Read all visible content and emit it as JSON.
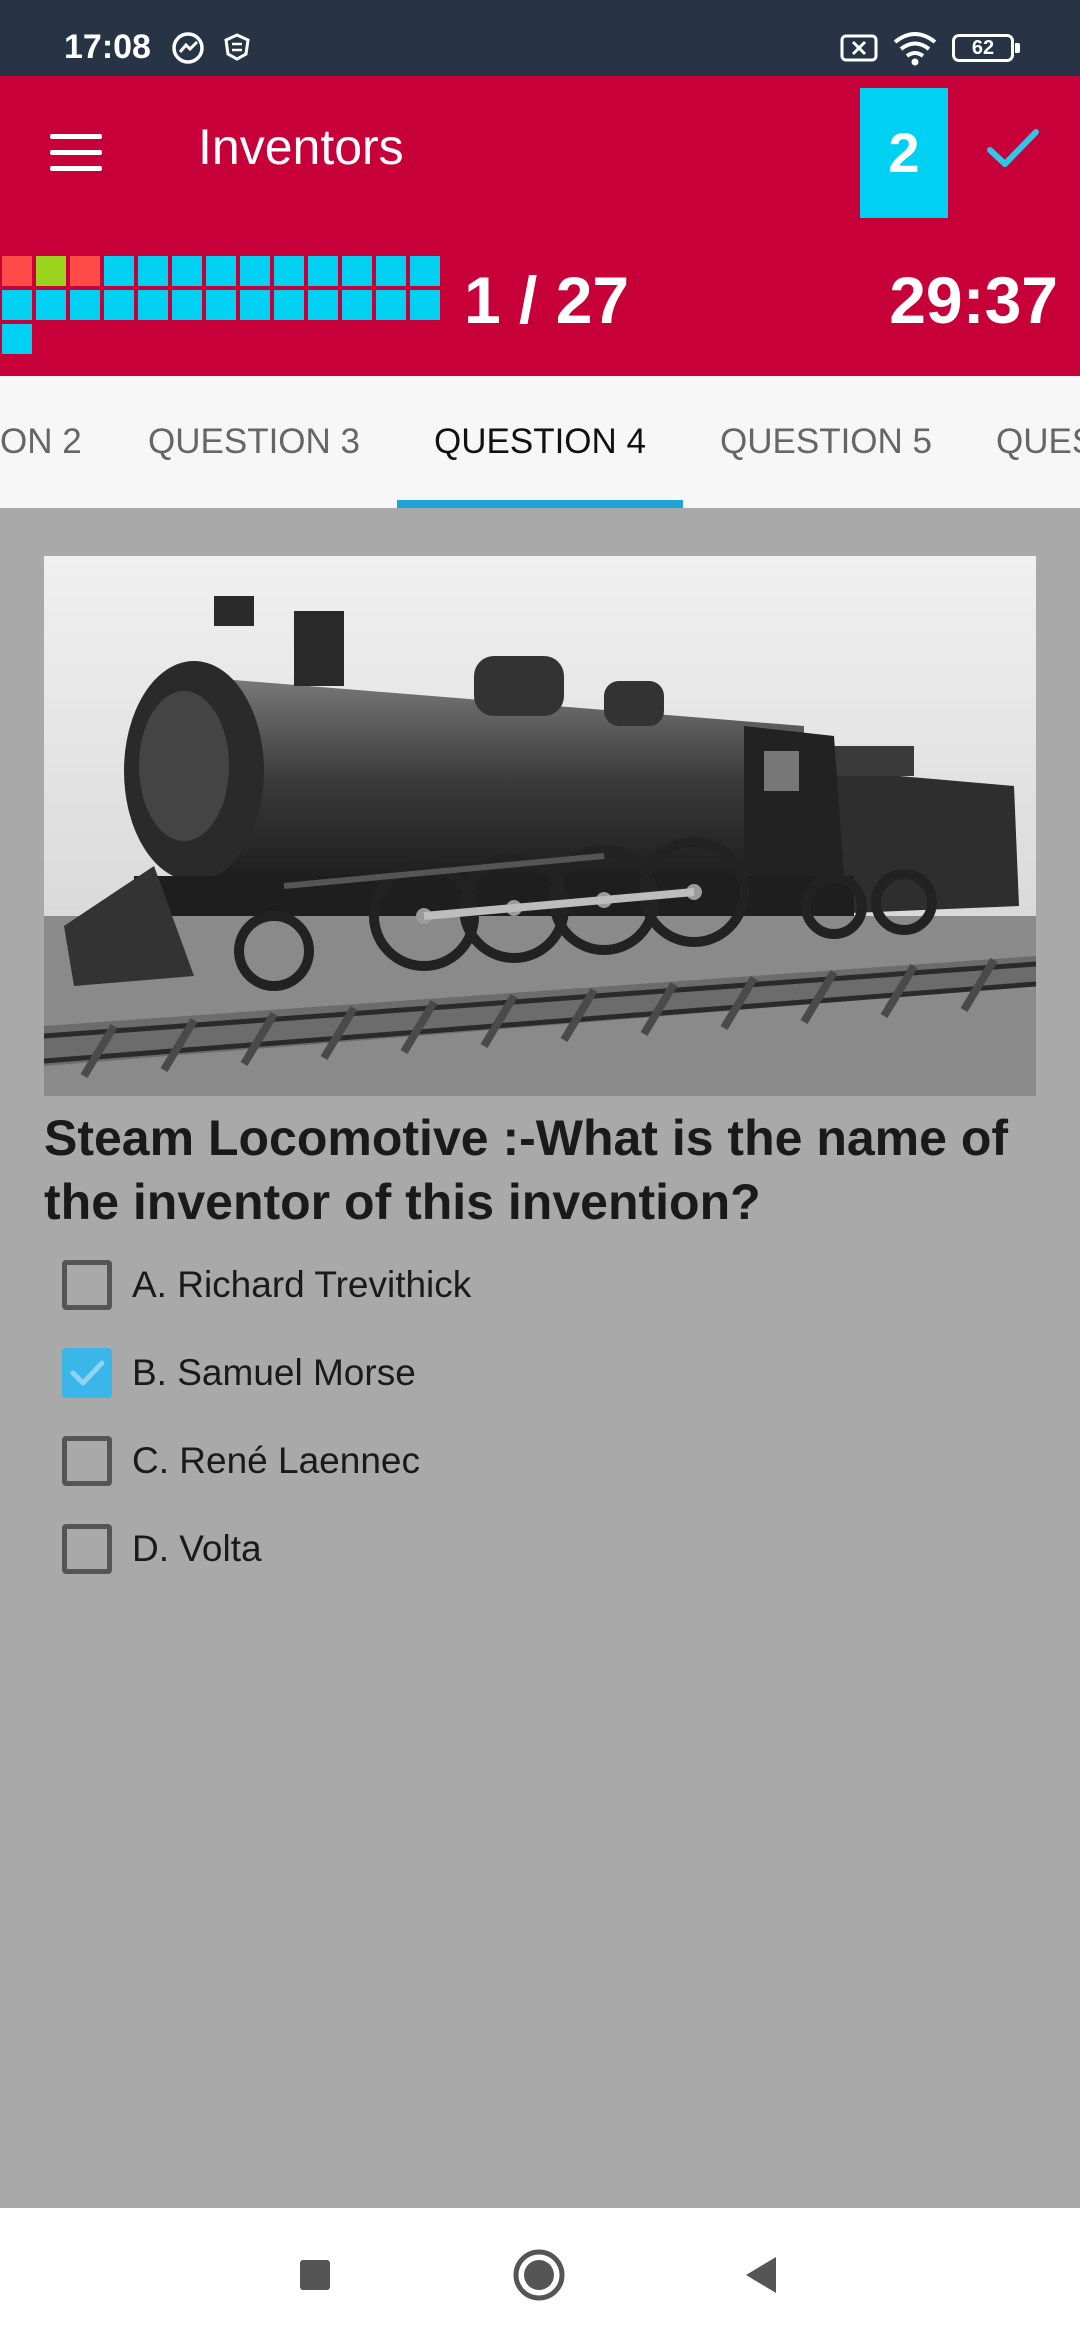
{
  "status_bar": {
    "time": "17:08",
    "battery": "62",
    "icons": [
      "chat-icon",
      "shield-icon",
      "sim-off-icon",
      "wifi-icon",
      "battery-icon"
    ]
  },
  "app_bar": {
    "title": "Inventors",
    "badge_count": "2",
    "progress": "1 / 27",
    "timer": "29:37",
    "colors": {
      "background": "#c8003a",
      "accent": "#00d0f2"
    }
  },
  "progress_cells": [
    "#ff4b48",
    "#9bd41f",
    "#ff4b48",
    "#00d0f2",
    "#00d0f2",
    "#00d0f2",
    "#00d0f2",
    "#00d0f2",
    "#00d0f2",
    "#00d0f2",
    "#00d0f2",
    "#00d0f2",
    "#00d0f2",
    "#00d0f2",
    "#00d0f2",
    "#00d0f2",
    "#00d0f2",
    "#00d0f2",
    "#00d0f2",
    "#00d0f2",
    "#00d0f2",
    "#00d0f2",
    "#00d0f2",
    "#00d0f2",
    "#00d0f2",
    "#00d0f2",
    "#00d0f2"
  ],
  "tabs": [
    {
      "label": "ON 2"
    },
    {
      "label": "QUESTION 3"
    },
    {
      "label": "QUESTION 4"
    },
    {
      "label": "QUESTION 5"
    },
    {
      "label": "QUES"
    }
  ],
  "active_tab_index": 2,
  "question": {
    "text": "Steam Locomotive :-What is the name of the inventor of this invention?",
    "options": [
      {
        "label": "A. Richard Trevithick",
        "checked": false
      },
      {
        "label": "B. Samuel Morse",
        "checked": true
      },
      {
        "label": "C. René Laennec",
        "checked": false
      },
      {
        "label": "D. Volta",
        "checked": false
      }
    ]
  },
  "nav": {
    "icons": [
      "recents-icon",
      "home-icon",
      "back-icon"
    ]
  }
}
